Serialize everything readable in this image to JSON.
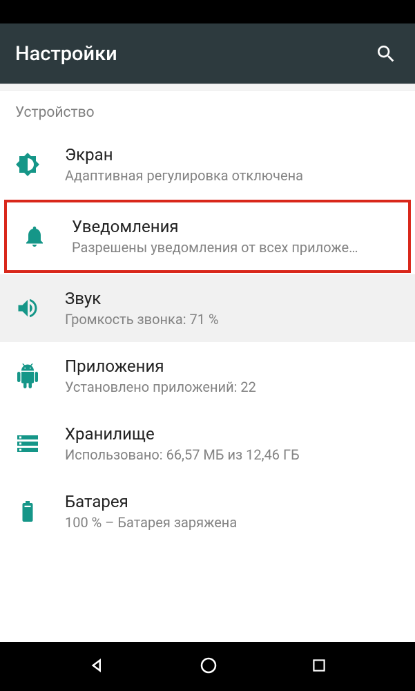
{
  "header": {
    "title": "Настройки"
  },
  "section": {
    "label": "Устройство"
  },
  "items": [
    {
      "icon": "display",
      "title": "Экран",
      "subtitle": "Адаптивная регулировка отключена",
      "highlighted": false,
      "selected": false
    },
    {
      "icon": "bell",
      "title": "Уведомления",
      "subtitle": "Разрешены уведомления от всех приложе…",
      "highlighted": true,
      "selected": false
    },
    {
      "icon": "volume",
      "title": "Звук",
      "subtitle": "Громкость звонка: 71 %",
      "highlighted": false,
      "selected": true
    },
    {
      "icon": "apps",
      "title": "Приложения",
      "subtitle": "Установлено приложений: 22",
      "highlighted": false,
      "selected": false
    },
    {
      "icon": "storage",
      "title": "Хранилище",
      "subtitle": "Использовано: 66,57 МБ из 12,46 ГБ",
      "highlighted": false,
      "selected": false
    },
    {
      "icon": "battery",
      "title": "Батарея",
      "subtitle": "100 % – Батарея заряжена",
      "highlighted": false,
      "selected": false
    }
  ],
  "colors": {
    "accent": "#159688",
    "highlight": "#d9281b",
    "appbar": "#2d3a3e"
  }
}
